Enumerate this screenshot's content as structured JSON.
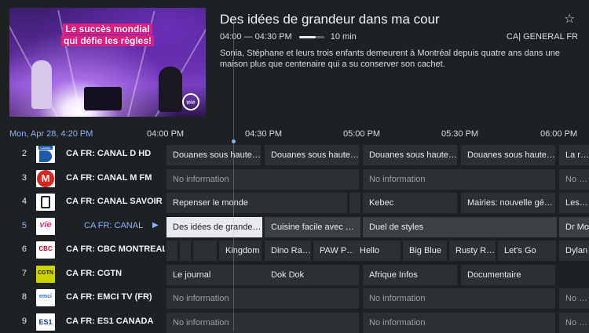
{
  "program": {
    "title": "Des idées de grandeur dans ma cour",
    "time_range": "04:00 — 04:30 PM",
    "remaining": "10 min",
    "progress_fraction": 0.67,
    "channel": "CA| GENERAL FR",
    "description": "Sonia, Stéphane et leurs trois enfants demeurent à Montréal depuis quatre ans dans une maison plus que centenaire qui a su conserver son cachet.",
    "preview_caption_line1": "Le succès mondial",
    "preview_caption_line2": "qui défie les règles!",
    "preview_logo": "télé"
  },
  "timeline": {
    "date": "Mon, Apr 28, 4:20 PM",
    "ticks": [
      "04:00 PM",
      "04:30 PM",
      "05:00 PM",
      "05:30 PM",
      "06:00 PM"
    ]
  },
  "channels": [
    {
      "num": "2",
      "name": "CA FR: CANAL D HD",
      "logo": "canal-d",
      "logo_text": "CANAL",
      "programs": [
        {
          "title": "Douanes sous haute surveillance",
          "style": "normal"
        },
        {
          "title": "Douanes sous haute surveillance",
          "style": "normal"
        },
        {
          "title": "Douanes sous haute surveillance",
          "style": "normal"
        },
        {
          "title": "Douanes sous haute surveillance",
          "style": "normal"
        },
        {
          "title": "La ruée",
          "style": "normal"
        }
      ]
    },
    {
      "num": "3",
      "name": "CA FR: CANAL M FM",
      "logo": "canal-m",
      "logo_text": "M",
      "programs": [
        {
          "title": "No information",
          "style": "dim"
        },
        {
          "title": "No information",
          "style": "dim"
        },
        {
          "title": "No information",
          "style": "dim"
        }
      ]
    },
    {
      "num": "4",
      "name": "CA FR: CANAL SAVOIR",
      "logo": "savoir",
      "logo_text": "",
      "programs": [
        {
          "title": "Repenser le monde",
          "style": "normal"
        },
        {
          "title": "",
          "style": "normal"
        },
        {
          "title": "Kebec",
          "style": "normal"
        },
        {
          "title": "Mairies: nouvelle génération",
          "style": "normal"
        },
        {
          "title": "Les Gr",
          "style": "normal"
        }
      ]
    },
    {
      "num": "5",
      "name": "CA FR: CANAL VIE",
      "logo": "vie",
      "logo_text": "vie",
      "selected": true,
      "programs": [
        {
          "title": "Des idées de grandeur dans ma cour",
          "style": "focus"
        },
        {
          "title": "Cuisine facile avec Marie",
          "style": "hl"
        },
        {
          "title": "Duel de styles",
          "style": "hl"
        },
        {
          "title": "Dr Mo",
          "style": "hl"
        }
      ]
    },
    {
      "num": "6",
      "name": "CA FR: CBC MONTREAL HD",
      "logo": "cbc",
      "logo_text": "CBC",
      "programs": [
        {
          "title": "",
          "style": "normal"
        },
        {
          "title": "",
          "style": "normal"
        },
        {
          "title": "",
          "style": "normal"
        },
        {
          "title": "Kingdom",
          "style": "normal"
        },
        {
          "title": "Dino Ranch",
          "style": "normal"
        },
        {
          "title": "PAW Patrol",
          "style": "normal"
        },
        {
          "title": "Hello",
          "style": "normal"
        },
        {
          "title": "Big Blue",
          "style": "normal"
        },
        {
          "title": "Rusty Rivets",
          "style": "normal"
        },
        {
          "title": "Let's Go",
          "style": "normal"
        },
        {
          "title": "",
          "style": "normal"
        },
        {
          "title": "Dylan",
          "style": "normal"
        }
      ]
    },
    {
      "num": "7",
      "name": "CA FR: CGTN",
      "logo": "cgtn",
      "logo_text": "CGTN",
      "programs": [
        {
          "title": "Le journal",
          "style": "normal"
        },
        {
          "title": "Dok Dok",
          "style": "normal"
        },
        {
          "title": "Afrique Infos",
          "style": "normal"
        },
        {
          "title": "Documentaire",
          "style": "normal"
        }
      ]
    },
    {
      "num": "8",
      "name": "CA FR: EMCI TV (FR)",
      "logo": "emci",
      "logo_text": "emci",
      "programs": [
        {
          "title": "No information",
          "style": "dim"
        },
        {
          "title": "No information",
          "style": "dim"
        },
        {
          "title": "No information",
          "style": "dim"
        }
      ]
    },
    {
      "num": "9",
      "name": "CA FR: ES1 CANADA",
      "logo": "es1",
      "logo_text": "ES1",
      "programs": [
        {
          "title": "No information",
          "style": "dim"
        },
        {
          "title": "No information",
          "style": "dim"
        },
        {
          "title": "No information",
          "style": "dim"
        }
      ]
    }
  ]
}
